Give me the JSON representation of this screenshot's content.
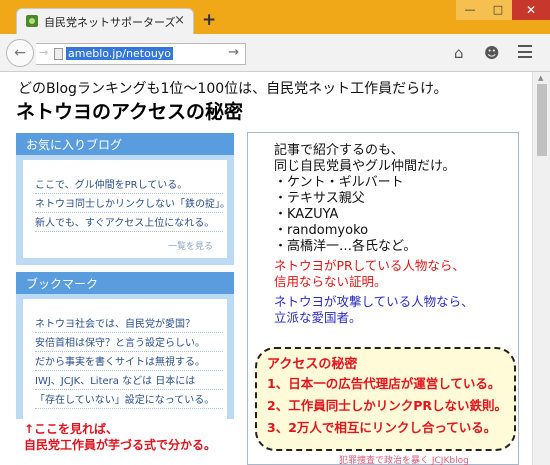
{
  "browser": {
    "tab_title": "自民党ネットサポーターズ",
    "tab_close": "×",
    "new_tab": "+",
    "url": "ameblo.jp/netouyo",
    "win_minimize": "—",
    "win_maximize": "□",
    "win_close": "✕",
    "back": "←",
    "forward": "→",
    "go": "→",
    "home_icon": "⌂",
    "chat_icon": "☻"
  },
  "page": {
    "heading_line1": "どのBlogランキングも1位〜100位は、自民党ネット工作員だらけ。",
    "heading_line2": "ネトウヨのアクセスの秘密"
  },
  "favorites": {
    "title": "お気に入りブログ",
    "items": [
      "ここで、グル仲間をPRしている。",
      "ネトウヨ同士しかリンクしない「鉄の掟」。",
      "新人でも、すぐアクセス上位になれる。"
    ],
    "more": "一覧を見る"
  },
  "bookmarks": {
    "title": "ブックマーク",
    "items": [
      "ネトウヨ社会では、自民党が愛国？",
      "安倍首相は保守？と言う設定らしい。",
      "だから事実を書くサイトは無視する。",
      "IWJ、JCJK、Litera などは 日本には",
      "「存在していない」設定になっている。"
    ]
  },
  "left_note": {
    "line1": "↑ここを見れば、",
    "line2": "自民党工作員が芋づる式で分かる。"
  },
  "right_box": {
    "lines": [
      "記事で紹介するのも、",
      "同じ自民党員やグル仲間だけ。",
      "・ケント・ギルバート",
      "・テキサス親父",
      "・KAZUYA",
      "・randomyoko",
      "・高橋洋一…各氏など。"
    ],
    "red_lines": [
      "ネトウヨがPRしている人物なら、",
      "信用ならない証明。"
    ],
    "blue_lines": [
      "ネトウヨが攻撃している人物なら、",
      "立派な愛国者。"
    ]
  },
  "secret_box": {
    "title": "アクセスの秘密",
    "items": [
      "1、日本一の広告代理店が運営している。",
      "2、工作員同士しかリンクPRしない鉄則。",
      "3、2万人で相互にリンクし合っている。"
    ]
  },
  "footer_note": "犯罪捜査で政治を暴く JCJKblog",
  "colors": {
    "tabbar": "#f0a818",
    "panel_bg": "#bcdaf4",
    "panel_title": "#5a9ddf",
    "red": "#e4141c",
    "blue": "#2a2ac8"
  }
}
